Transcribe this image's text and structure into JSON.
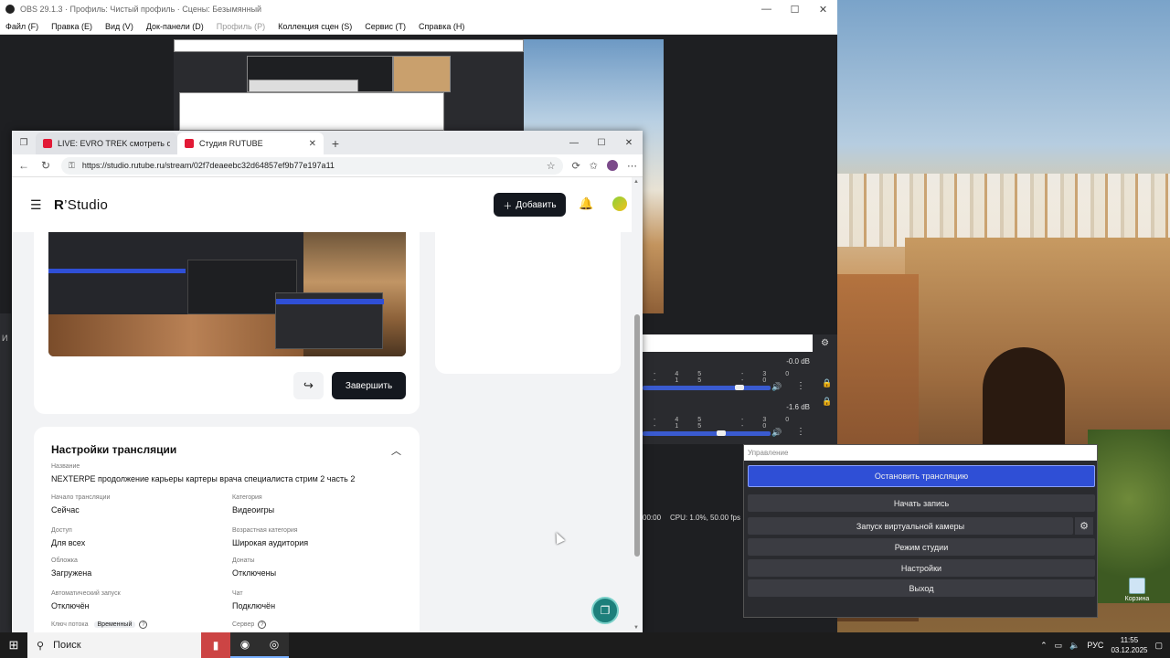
{
  "obs": {
    "title": "OBS 29.1.3 · Профиль: Чистый профиль · Сцены: Безымянный",
    "window_controls": [
      "—",
      "☐",
      "✕"
    ],
    "menu": [
      "Файл (F)",
      "Правка (E)",
      "Вид (V)",
      "Док-панели (D)",
      "Профиль (P)",
      "Коллекция сцен (S)",
      "Сервис (T)",
      "Справка (H)"
    ],
    "mixer": {
      "track1": {
        "db": "-0.0 dB",
        "scale": "-45 -30 -15 -0",
        "level": 0.72
      },
      "track2": {
        "db": "-1.6 dB",
        "scale": "-45 -30 -15 -0",
        "level": 0.58
      }
    },
    "status": {
      "time": "00:00",
      "cpu": "CPU: 1.0%, 50.00 fps"
    },
    "controls": {
      "header": "Управление",
      "stop_stream": "Остановить трансляцию",
      "start_recording": "Начать запись",
      "virtual_camera": "Запуск виртуальной камеры",
      "studio_mode": "Режим студии",
      "settings": "Настройки",
      "exit": "Выход"
    }
  },
  "browser": {
    "tabs": [
      {
        "label": "LIVE: EVRO TREK смотреть онлайн",
        "active": false
      },
      {
        "label": "Студия RUTUBE",
        "active": true
      }
    ],
    "window_controls": [
      "—",
      "☐",
      "✕"
    ],
    "url": "https://studio.rutube.ru/stream/02f7deaeebc32d64857ef9b77e197a11"
  },
  "studio": {
    "brand_r": "R",
    "brand_studio": "Studio",
    "add_button": "Добавить",
    "finish_button": "Завершить",
    "settings": {
      "title": "Настройки трансляции",
      "name_label": "Название",
      "name_value": "NEXTERPE продолжение карьеры картеры врача специалиста стрим 2 часть 2",
      "start_label": "Начало трансляции",
      "start_value": "Сейчас",
      "category_label": "Категория",
      "category_value": "Видеоигры",
      "access_label": "Доступ",
      "access_value": "Для всех",
      "age_label": "Возрастная категория",
      "age_value": "Широкая аудитория",
      "cover_label": "Обложка",
      "cover_value": "Загружена",
      "donations_label": "Донаты",
      "donations_value": "Отключены",
      "autostart_label": "Автоматический запуск",
      "autostart_value": "Отключён",
      "chat_label": "Чат",
      "chat_value": "Подключён",
      "stream_key_label": "Ключ потока",
      "stream_key_pill": "Временный",
      "server_label": "Сервер"
    }
  },
  "desktop": {
    "recycle_bin": "Корзина"
  },
  "taskbar": {
    "search_placeholder": "Поиск",
    "language": "РУС",
    "time": "11:55",
    "date": "03.12.2025"
  }
}
